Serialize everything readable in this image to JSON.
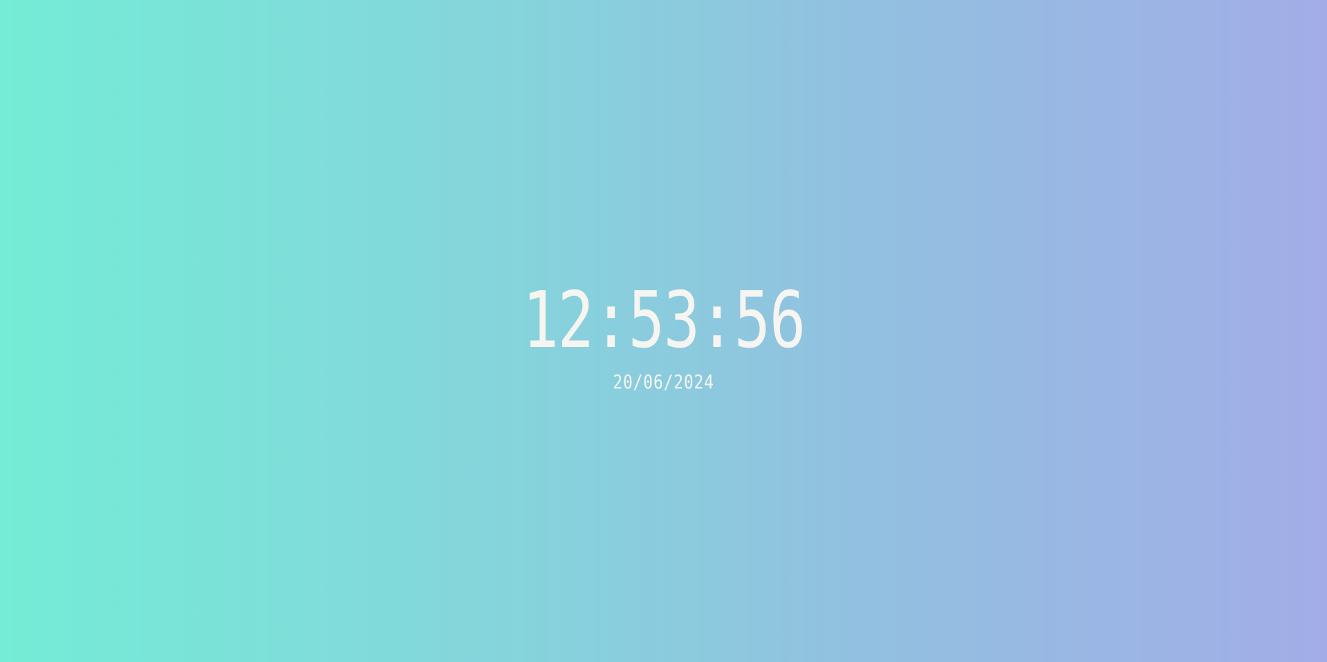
{
  "clock": {
    "time": "12:53:56",
    "date": "20/06/2024"
  },
  "colors": {
    "gradient_start": "#74ecd6",
    "gradient_end": "#a2ade7",
    "text": "#f7f5f1"
  }
}
